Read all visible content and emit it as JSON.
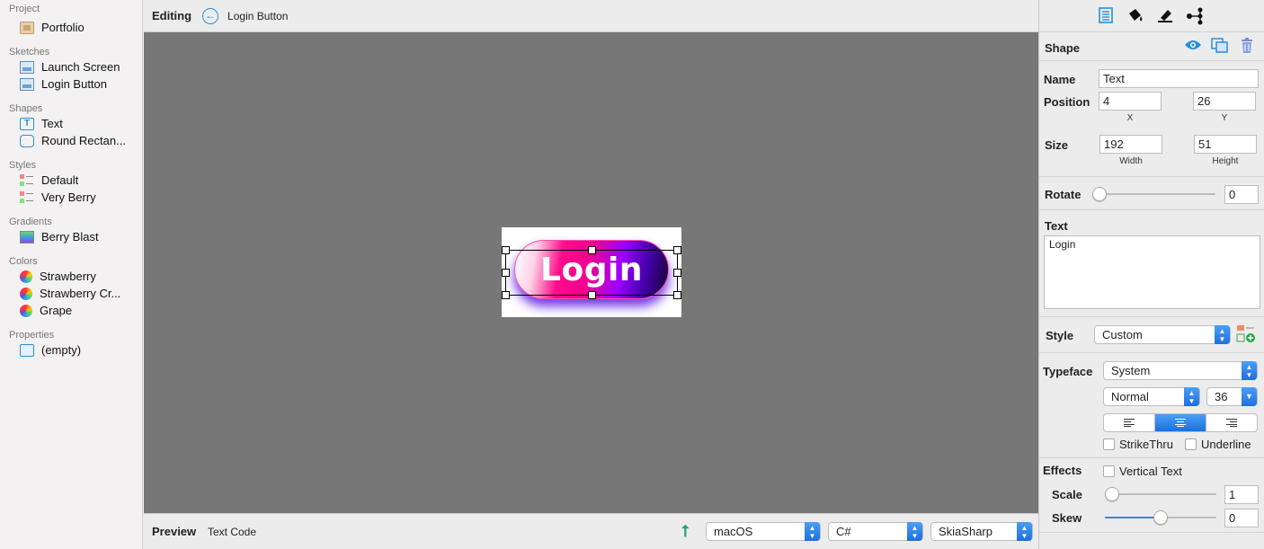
{
  "sidebar": {
    "sections": {
      "project": "Project",
      "sketches": "Sketches",
      "shapes": "Shapes",
      "styles": "Styles",
      "gradients": "Gradients",
      "colors": "Colors",
      "properties": "Properties"
    },
    "project_items": [
      "Portfolio"
    ],
    "sketch_items": [
      "Launch Screen",
      "Login Button"
    ],
    "shape_items": [
      "Text",
      "Round Rectan..."
    ],
    "style_items": [
      "Default",
      "Very Berry"
    ],
    "gradient_items": [
      "Berry Blast"
    ],
    "color_items": [
      "Strawberry",
      "Strawberry Cr...",
      "Grape"
    ],
    "property_items": [
      "(empty)"
    ]
  },
  "topbar": {
    "mode": "Editing",
    "back_icon": "back-arrow-icon",
    "breadcrumb": "Login Button"
  },
  "canvas": {
    "button_text": "Login",
    "button_gradient": [
      "#ffffff",
      "#ff0d8a",
      "#9b00ff",
      "#150030"
    ],
    "background_color": "#777777"
  },
  "preview": {
    "title": "Preview",
    "tab": "Text Code",
    "platform": "macOS",
    "language": "C#",
    "library": "SkiaSharp"
  },
  "inspector": {
    "toolbar_icons": [
      "document-icon",
      "paint-bucket-icon",
      "highlighter-icon",
      "connections-icon"
    ],
    "section_title": "Shape",
    "name_label": "Name",
    "name_value": "Text",
    "position_label": "Position",
    "x_value": "4",
    "y_value": "26",
    "x_label": "X",
    "y_label": "Y",
    "size_label": "Size",
    "width_value": "192",
    "height_value": "51",
    "width_label": "Width",
    "height_label": "Height",
    "rotate_label": "Rotate",
    "rotate_value": "0",
    "text_label": "Text",
    "text_value": "Login",
    "style_label": "Style",
    "style_value": "Custom",
    "typeface_label": "Typeface",
    "typeface_value": "System",
    "weight_value": "Normal",
    "font_size_value": "36",
    "alignment_selected": "center",
    "strikethru_label": "StrikeThru",
    "underline_label": "Underline",
    "effects_label": "Effects",
    "vertical_text_label": "Vertical Text",
    "scale_label": "Scale",
    "scale_value": "1",
    "skew_label": "Skew",
    "skew_value": "0",
    "skew_level": 0.5,
    "accent_color": "#2a8fd8"
  }
}
